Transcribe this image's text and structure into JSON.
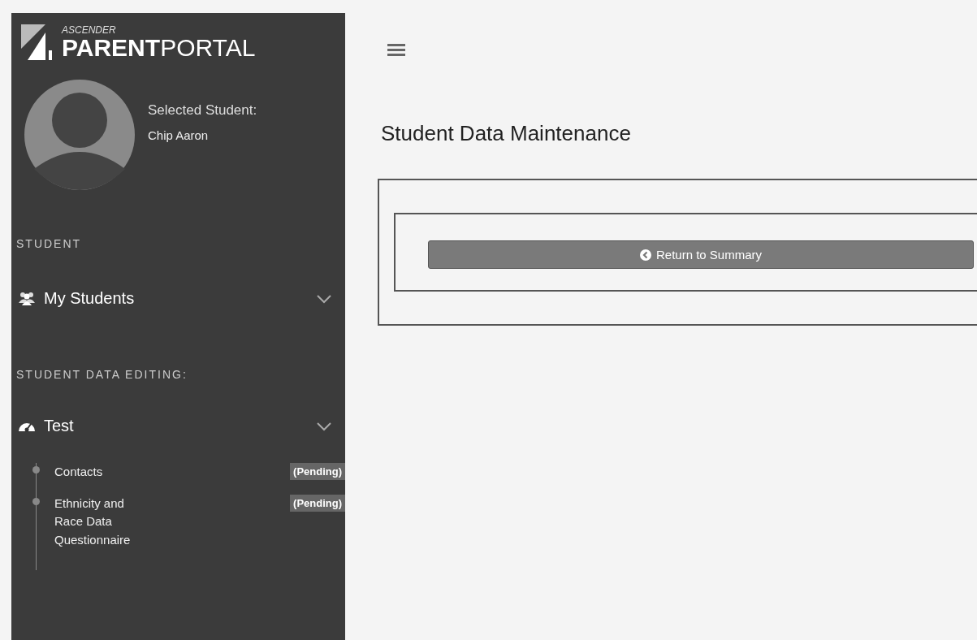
{
  "logo": {
    "small": "ASCENDER",
    "bold": "PARENT",
    "light": "PORTAL"
  },
  "selected_student": {
    "label": "Selected Student:",
    "name": "Chip Aaron"
  },
  "sidebar": {
    "sections": [
      {
        "heading": "STUDENT",
        "items": [
          {
            "label": "My Students",
            "kind": "users"
          }
        ]
      },
      {
        "heading": "STUDENT DATA EDITING:",
        "items": [
          {
            "label": "Test",
            "kind": "dashboard",
            "children": [
              {
                "label": "Contacts",
                "badge": "(Pending)"
              },
              {
                "label": "Ethnicity and Race Data Questionnaire",
                "badge": "(Pending)"
              }
            ]
          }
        ]
      }
    ]
  },
  "page": {
    "title": "Student Data Maintenance",
    "button": "Return to Summary"
  }
}
